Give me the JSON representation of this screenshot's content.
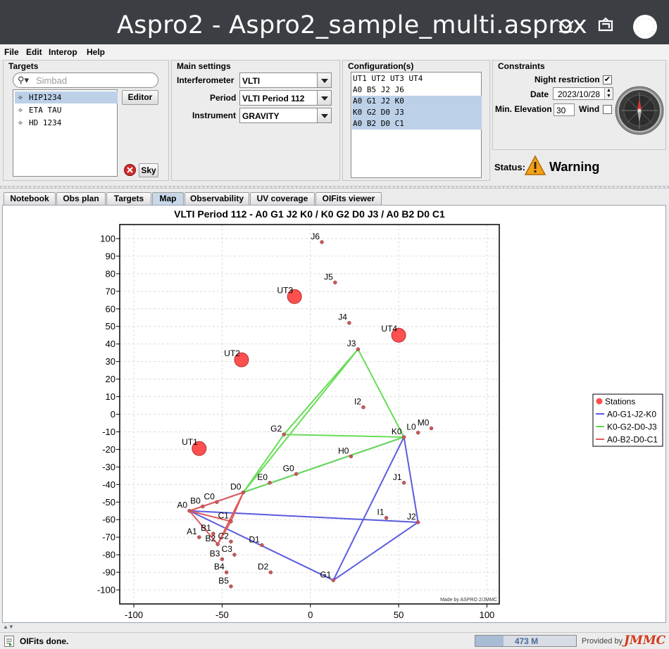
{
  "window": {
    "title": "Aspro2 - Aspro2_sample_multi.asprox"
  },
  "menu": [
    "File",
    "Edit",
    "Interop",
    "Help"
  ],
  "targets": {
    "title": "Targets",
    "search_placeholder": "Simbad",
    "items": [
      "HIP1234",
      "ETA TAU",
      "HD 1234"
    ],
    "editor_label": "Editor",
    "sky_label": "Sky"
  },
  "main_settings": {
    "title": "Main settings",
    "interferometer_label": "Interferometer",
    "interferometer_value": "VLTI",
    "period_label": "Period",
    "period_value": "VLTI Period 112",
    "instrument_label": "Instrument",
    "instrument_value": "GRAVITY"
  },
  "configurations": {
    "title": "Configuration(s)",
    "items": [
      "UT1 UT2 UT3 UT4",
      "A0 B5 J2 J6",
      "A0 G1 J2 K0",
      "K0 G2 D0 J3",
      "A0 B2 D0 C1"
    ],
    "selected": [
      "A0 G1 J2 K0",
      "K0 G2 D0 J3",
      "A0 B2 D0 C1"
    ]
  },
  "constraints": {
    "title": "Constraints",
    "night_label": "Night restriction",
    "night_checked": true,
    "date_label": "Date",
    "date_value": "2023/10/28",
    "elev_label": "Min. Elevation",
    "elev_value": "30",
    "wind_label": "Wind",
    "wind_checked": false
  },
  "status": {
    "label": "Status:",
    "value": "Warning"
  },
  "tabs": [
    "Notebook",
    "Obs plan",
    "Targets",
    "Map",
    "Observability",
    "UV coverage",
    "OIFits viewer"
  ],
  "active_tab": "Map",
  "chart_data": {
    "type": "scatter",
    "title": "VLTI Period 112 - A0 G1 J2 K0 / K0 G2 D0 J3 / A0 B2 D0 C1",
    "xlim": [
      -108,
      107
    ],
    "ylim": [
      -108,
      108
    ],
    "xticks": [
      -100,
      -50,
      0,
      50,
      100
    ],
    "yticks": [
      100,
      90,
      80,
      70,
      60,
      50,
      40,
      30,
      20,
      10,
      0,
      -10,
      -20,
      -30,
      -40,
      -50,
      -60,
      -70,
      -80,
      -90,
      -100
    ],
    "grid": true,
    "legend_position": "right",
    "watermark": "Made by ASPRO 2/JMMC",
    "stations": [
      {
        "name": "UT1",
        "x": -63,
        "y": -19.5,
        "ut": true
      },
      {
        "name": "UT2",
        "x": -39,
        "y": 31,
        "ut": true
      },
      {
        "name": "UT3",
        "x": -9,
        "y": 67,
        "ut": true
      },
      {
        "name": "UT4",
        "x": 50,
        "y": 45,
        "ut": true
      },
      {
        "name": "J6",
        "x": 6.5,
        "y": 98,
        "ut": false
      },
      {
        "name": "J5",
        "x": 14,
        "y": 75,
        "ut": false
      },
      {
        "name": "J4",
        "x": 22,
        "y": 52,
        "ut": false
      },
      {
        "name": "J3",
        "x": 27,
        "y": 37,
        "ut": false
      },
      {
        "name": "I2",
        "x": 30,
        "y": 4,
        "ut": false
      },
      {
        "name": "K0",
        "x": 53,
        "y": -13,
        "ut": false
      },
      {
        "name": "L0",
        "x": 61,
        "y": -10.5,
        "ut": false
      },
      {
        "name": "M0",
        "x": 68.5,
        "y": -8,
        "ut": false
      },
      {
        "name": "G2",
        "x": -15,
        "y": -11.5,
        "ut": false
      },
      {
        "name": "H0",
        "x": 23,
        "y": -24,
        "ut": false
      },
      {
        "name": "G0",
        "x": -8,
        "y": -34,
        "ut": false
      },
      {
        "name": "J1",
        "x": 53,
        "y": -39,
        "ut": false
      },
      {
        "name": "E0",
        "x": -23,
        "y": -39,
        "ut": false
      },
      {
        "name": "D0",
        "x": -38,
        "y": -44.5,
        "ut": false
      },
      {
        "name": "C0",
        "x": -53,
        "y": -50,
        "ut": false
      },
      {
        "name": "B0",
        "x": -61,
        "y": -52.5,
        "ut": false
      },
      {
        "name": "A0",
        "x": -68.5,
        "y": -55,
        "ut": false
      },
      {
        "name": "I1",
        "x": 43,
        "y": -59,
        "ut": false
      },
      {
        "name": "J2",
        "x": 61,
        "y": -61.5,
        "ut": false
      },
      {
        "name": "B1",
        "x": -55,
        "y": -68,
        "ut": false
      },
      {
        "name": "A1",
        "x": -63,
        "y": -70,
        "ut": false
      },
      {
        "name": "C1",
        "x": -45,
        "y": -61,
        "ut": false
      },
      {
        "name": "C2",
        "x": -45,
        "y": -72.5,
        "ut": false
      },
      {
        "name": "B2",
        "x": -52.5,
        "y": -74,
        "ut": false
      },
      {
        "name": "D1",
        "x": -27.5,
        "y": -74.5,
        "ut": false
      },
      {
        "name": "C3",
        "x": -43,
        "y": -80,
        "ut": false
      },
      {
        "name": "B3",
        "x": -50,
        "y": -82.5,
        "ut": false
      },
      {
        "name": "B4",
        "x": -47.5,
        "y": -90,
        "ut": false
      },
      {
        "name": "D2",
        "x": -22.5,
        "y": -90,
        "ut": false
      },
      {
        "name": "G1",
        "x": 13,
        "y": -94.5,
        "ut": false
      },
      {
        "name": "B5",
        "x": -45,
        "y": -98,
        "ut": false
      }
    ],
    "series": [
      {
        "name": "A0-G1-J2-K0",
        "color": "#5b5bdf",
        "stations": [
          "A0",
          "G1",
          "J2",
          "K0"
        ]
      },
      {
        "name": "K0-G2-D0-J3",
        "color": "#66dd55",
        "stations": [
          "K0",
          "G2",
          "D0",
          "J3"
        ]
      },
      {
        "name": "A0-B2-D0-C1",
        "color": "#e05a5a",
        "stations": [
          "A0",
          "B2",
          "D0",
          "C1"
        ]
      }
    ],
    "legend_stations_label": "Stations"
  },
  "statusbar": {
    "message": "OIFits done.",
    "memory": "473 M",
    "memory_fraction": 0.28,
    "provided_by": "Provided by",
    "brand": "JMMC"
  }
}
